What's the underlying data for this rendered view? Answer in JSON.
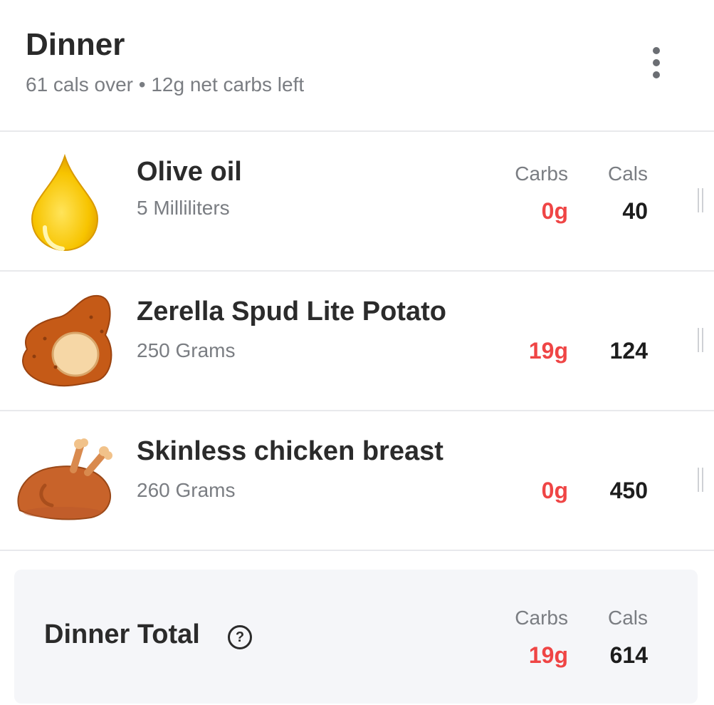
{
  "meal": {
    "title": "Dinner",
    "summary": "61 cals over • 12g net carbs left",
    "menu_icon": "more-vertical-icon"
  },
  "columns": {
    "carbs": "Carbs",
    "cals": "Cals"
  },
  "items": [
    {
      "name": "Olive oil",
      "amount": "5 Milliliters",
      "carbs": "0g",
      "cals": "40",
      "icon": "oil-drop-icon"
    },
    {
      "name": "Zerella Spud Lite Potato",
      "amount": "250 Grams",
      "carbs": "19g",
      "cals": "124",
      "icon": "potato-icon"
    },
    {
      "name": "Skinless chicken breast",
      "amount": "260 Grams",
      "carbs": "0g",
      "cals": "450",
      "icon": "roast-chicken-icon"
    }
  ],
  "total": {
    "label": "Dinner Total",
    "help_glyph": "?",
    "carbs": "19g",
    "cals": "614"
  },
  "colors": {
    "carbs_accent": "#ef4545",
    "divider": "#e8e9ec",
    "total_bg": "#f5f6f9"
  }
}
